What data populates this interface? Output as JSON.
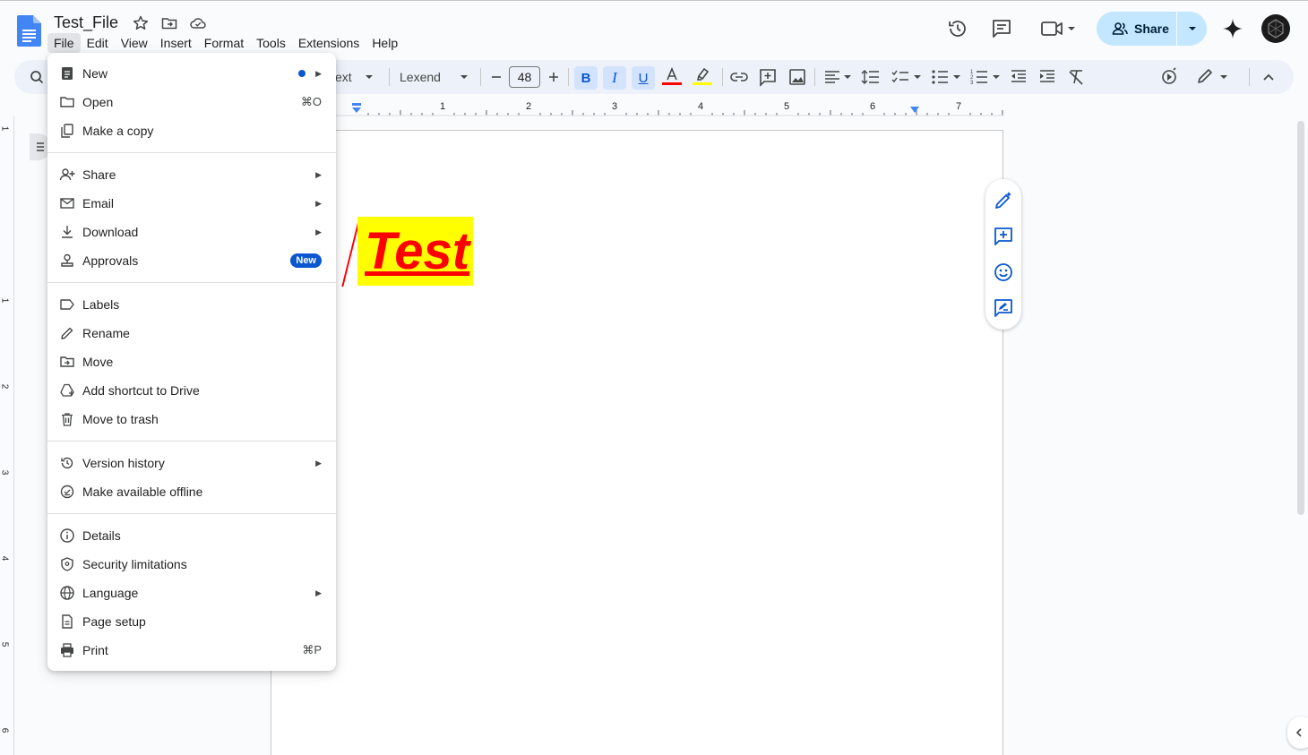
{
  "doc": {
    "title": "Test_File"
  },
  "menubar": [
    "File",
    "Edit",
    "View",
    "Insert",
    "Format",
    "Tools",
    "Extensions",
    "Help"
  ],
  "header": {
    "share_label": "Share"
  },
  "toolbar": {
    "style_label": "ext",
    "font_label": "Lexend",
    "font_size": "48",
    "bold_label": "B",
    "italic_label": "I",
    "underline_label": "U",
    "text_color": "#ff0000",
    "highlight_color": "#ffff00"
  },
  "ruler": {
    "numbers": [
      "1",
      "2",
      "3",
      "4",
      "5",
      "6",
      "7"
    ]
  },
  "vruler": {
    "numbers": [
      "1",
      "1",
      "2",
      "3",
      "4",
      "5",
      "6"
    ]
  },
  "document": {
    "text": "Test"
  },
  "file_menu": {
    "items": [
      {
        "label": "New",
        "icon": "doc-icon",
        "right": "dot-arrow"
      },
      {
        "label": "Open",
        "icon": "folder-icon",
        "shortcut": "⌘O"
      },
      {
        "label": "Make a copy",
        "icon": "copy-icon"
      },
      {
        "label": "Share",
        "icon": "person-add-icon",
        "right": "arrow"
      },
      {
        "label": "Email",
        "icon": "mail-icon",
        "right": "arrow"
      },
      {
        "label": "Download",
        "icon": "download-icon",
        "right": "arrow"
      },
      {
        "label": "Approvals",
        "icon": "approvals-icon",
        "badge": "New"
      },
      {
        "label": "Labels",
        "icon": "label-icon"
      },
      {
        "label": "Rename",
        "icon": "pencil-icon"
      },
      {
        "label": "Move",
        "icon": "move-folder-icon"
      },
      {
        "label": "Add shortcut to Drive",
        "icon": "drive-shortcut-icon"
      },
      {
        "label": "Move to trash",
        "icon": "trash-icon"
      },
      {
        "label": "Version history",
        "icon": "history-icon",
        "right": "arrow"
      },
      {
        "label": "Make available offline",
        "icon": "offline-icon"
      },
      {
        "label": "Details",
        "icon": "info-icon"
      },
      {
        "label": "Security limitations",
        "icon": "shield-icon"
      },
      {
        "label": "Language",
        "icon": "globe-icon",
        "right": "arrow"
      },
      {
        "label": "Page setup",
        "icon": "page-icon"
      },
      {
        "label": "Print",
        "icon": "print-icon",
        "shortcut": "⌘P"
      }
    ]
  },
  "colors": {
    "accent": "#0b57d0",
    "share_bg": "#c2e7ff",
    "toolbar_bg": "#edf2fa"
  }
}
